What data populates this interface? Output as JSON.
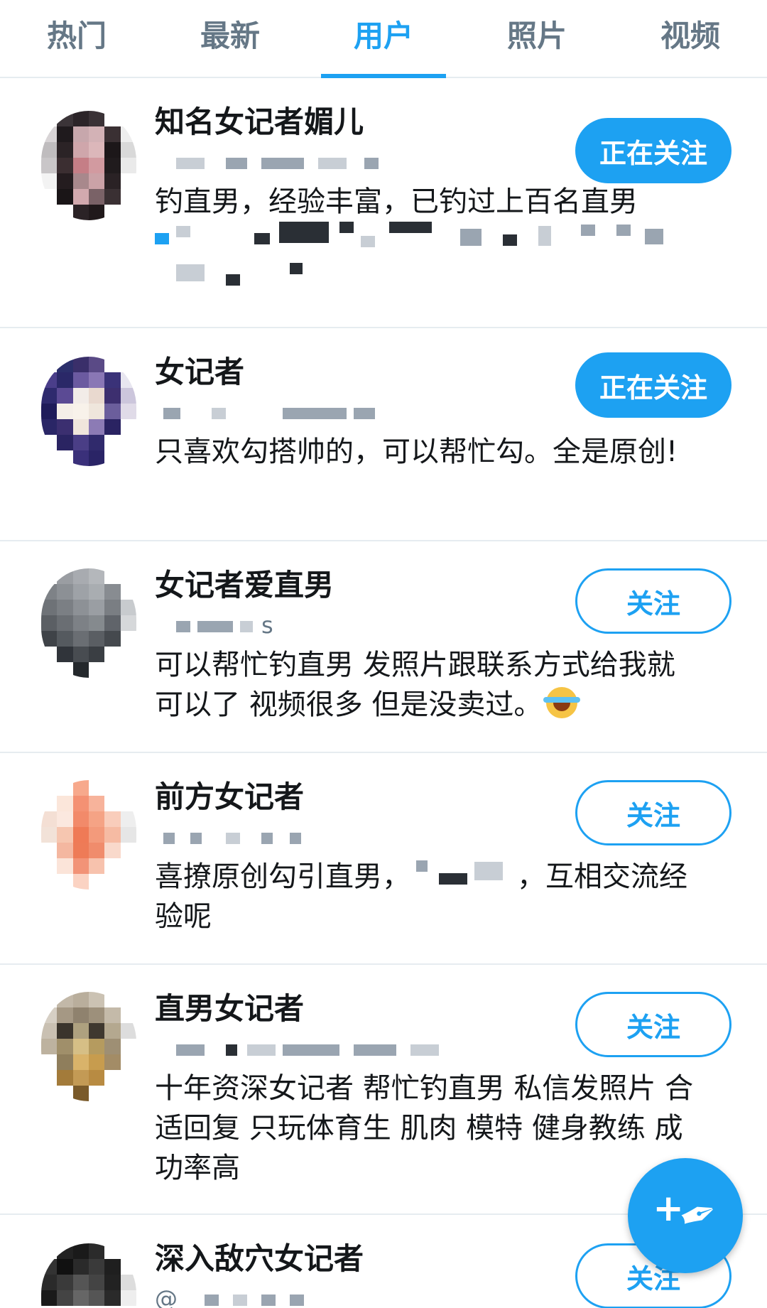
{
  "tabs": [
    {
      "label": "热门",
      "active": false
    },
    {
      "label": "最新",
      "active": false
    },
    {
      "label": "用户",
      "active": true
    },
    {
      "label": "照片",
      "active": false
    },
    {
      "label": "视频",
      "active": false
    }
  ],
  "users": [
    {
      "name": "知名女记者媚儿",
      "handle": "",
      "bio": "钓直男，经验丰富，已钓过上百名直男",
      "button": "正在关注",
      "following": true
    },
    {
      "name": "女记者",
      "handle": "",
      "bio": "只喜欢勾搭帅的，可以帮忙勾。全是原创!",
      "button": "正在关注",
      "following": true
    },
    {
      "name": "女记者爱直男",
      "handle": "s",
      "bio": "可以帮忙钓直男 发照片跟联系方式给我就可以了 视频很多 但是没卖过。",
      "bio_emoji": "joy-emoji",
      "button": "关注",
      "following": false
    },
    {
      "name": "前方女记者",
      "handle": "",
      "bio_part1": "喜撩原创勾引直男，",
      "bio_part2": "，互相交流经验呢",
      "button": "关注",
      "following": false
    },
    {
      "name": "直男女记者",
      "handle": "",
      "bio": "十年资深女记者 帮忙钓直男 私信发照片 合适回复 只玩体育生 肌肉 模特 健身教练 成功率高",
      "button": "关注",
      "following": false
    },
    {
      "name": "深入敌穴女记者",
      "handle": "@",
      "button": "关注",
      "following": false
    }
  ],
  "fab": {
    "plus": "+",
    "icon": "feather-quill-icon"
  },
  "colors": {
    "accent": "#1da1f2",
    "text": "#14171a",
    "muted": "#657786",
    "divider": "#e6ecf0"
  }
}
